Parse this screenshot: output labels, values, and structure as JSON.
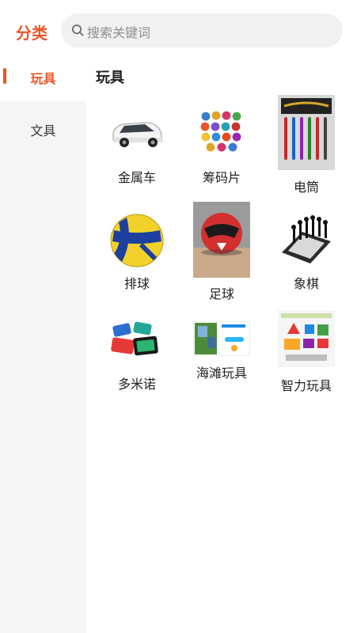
{
  "header": {
    "title": "分类",
    "search_placeholder": "搜索关键词"
  },
  "sidebar": {
    "items": [
      {
        "label": "玩具"
      },
      {
        "label": "文具"
      }
    ]
  },
  "main": {
    "section_title": "玩具",
    "products": [
      {
        "name": "金属车",
        "icon": "car-image"
      },
      {
        "name": "筹码片",
        "icon": "poker-chips-image"
      },
      {
        "name": "电筒",
        "icon": "flashlights-image"
      },
      {
        "name": "排球",
        "icon": "volleyball-image"
      },
      {
        "name": "足球",
        "icon": "soccer-ball-image"
      },
      {
        "name": "象棋",
        "icon": "chess-set-image"
      },
      {
        "name": "多米诺",
        "icon": "domino-image"
      },
      {
        "name": "海滩玩具",
        "icon": "beach-toys-image"
      },
      {
        "name": "智力玩具",
        "icon": "puzzle-toys-image"
      }
    ]
  }
}
